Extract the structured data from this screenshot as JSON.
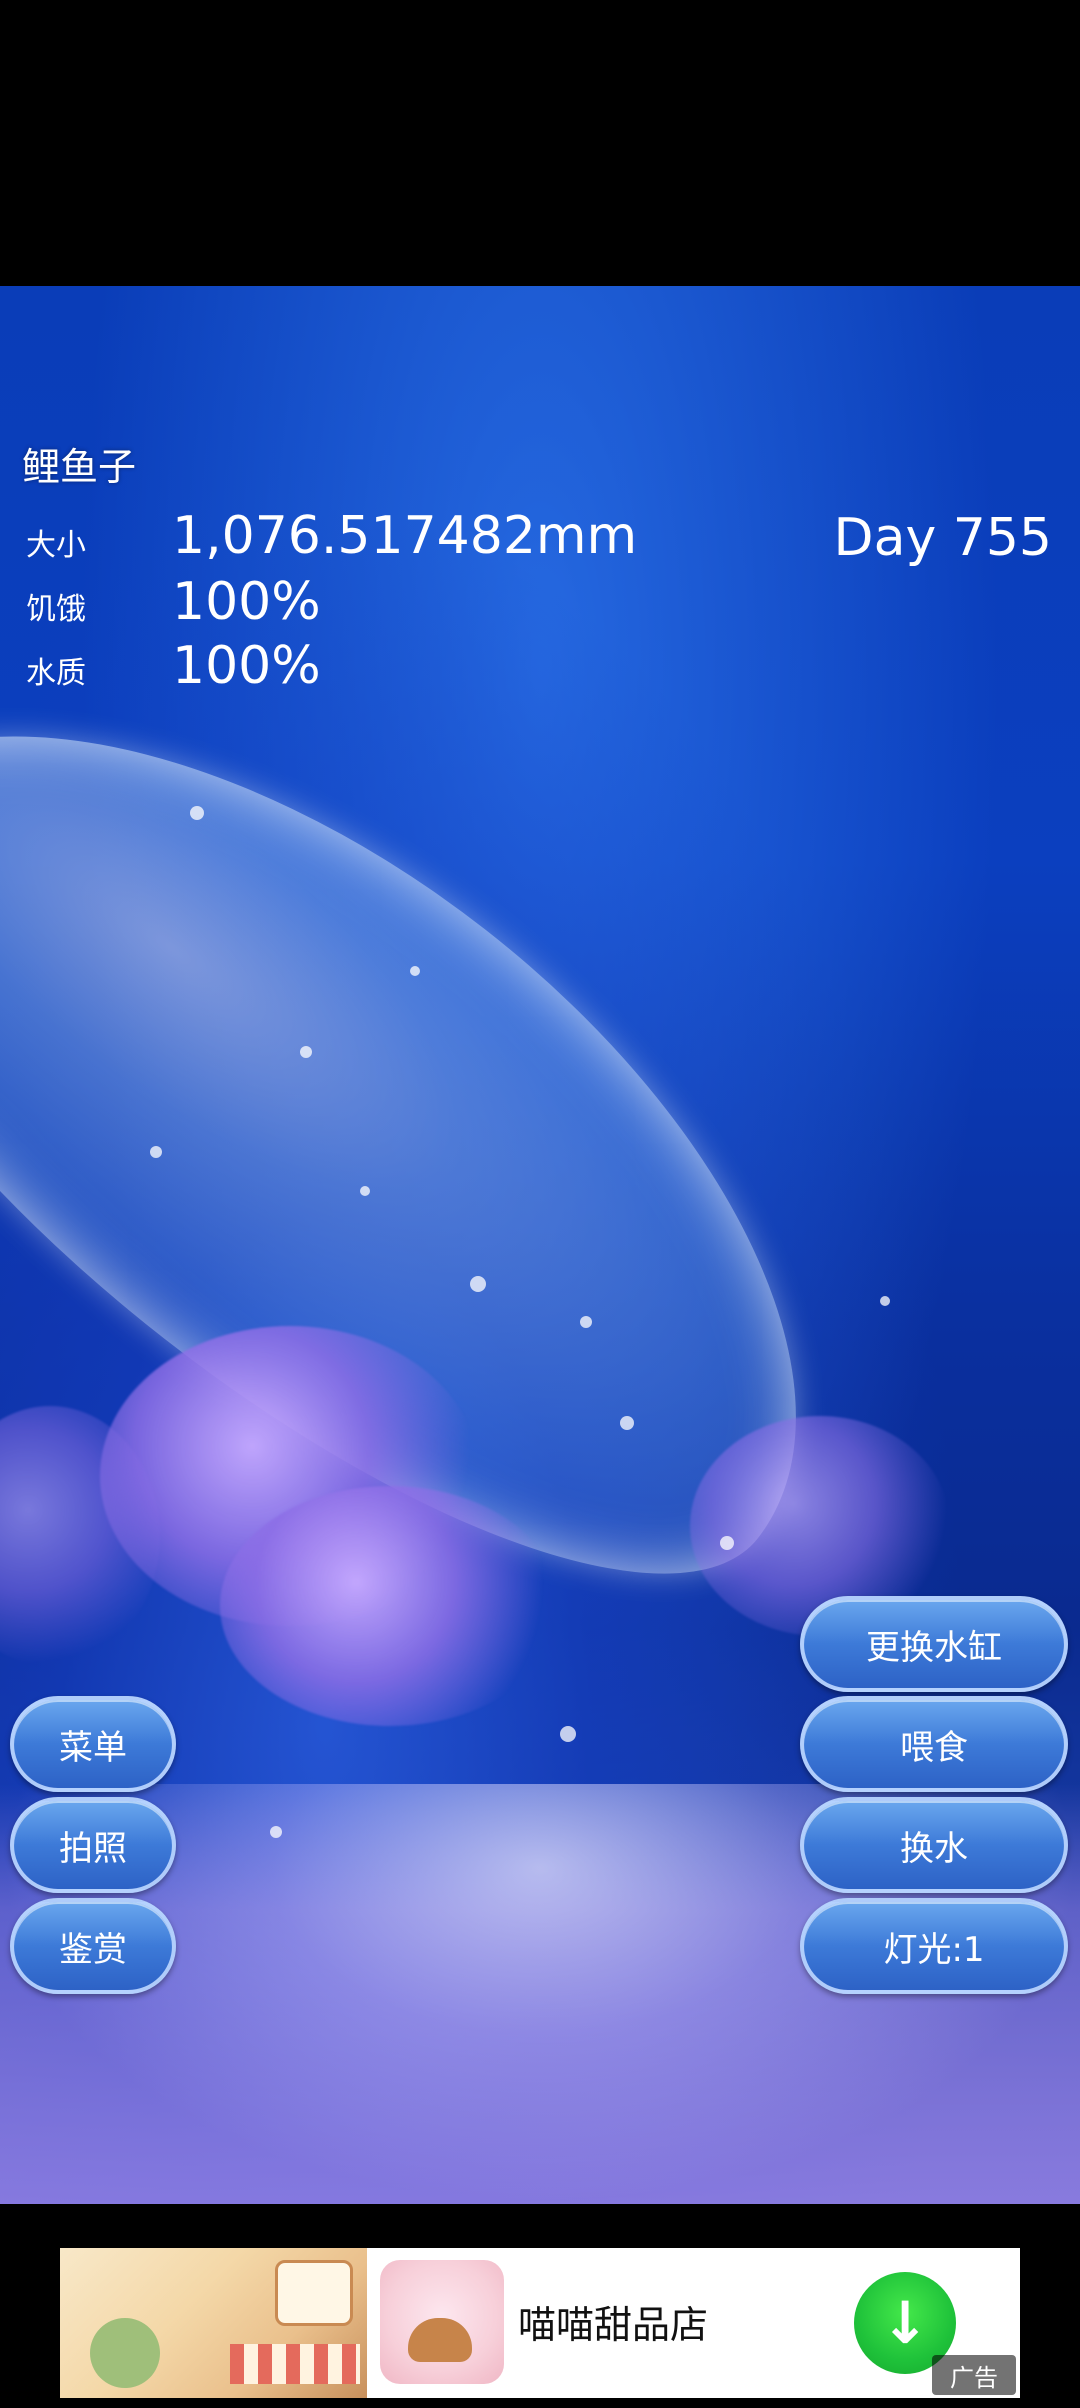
{
  "status": {
    "fish_name": "鲤鱼子",
    "size_label": "大小",
    "size_value": "1,076.517482mm",
    "hunger_label": "饥饿",
    "hunger_value": "100%",
    "water_label": "水质",
    "water_value": "100%",
    "day_label": "Day 755"
  },
  "buttons_left": [
    {
      "label": "菜单"
    },
    {
      "label": "拍照"
    },
    {
      "label": "鉴赏"
    }
  ],
  "buttons_right": [
    {
      "label": "更换水缸"
    },
    {
      "label": "喂食"
    },
    {
      "label": "换水"
    },
    {
      "label": "灯光:1"
    }
  ],
  "ad": {
    "title": "喵喵甜品店",
    "download_icon": "download-arrow-icon",
    "label": "广告"
  },
  "colors": {
    "water_blue": "#0a3db8",
    "button_blue": "#3d7ad8",
    "download_green": "#1fc23a"
  }
}
